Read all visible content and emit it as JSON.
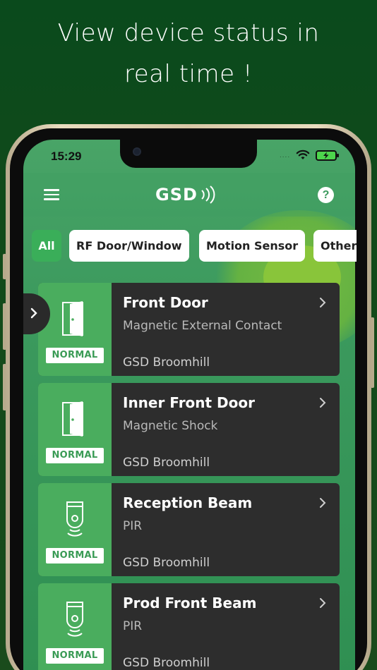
{
  "promo": {
    "line1": "View device status in",
    "line2": "real time !"
  },
  "status_bar": {
    "time": "15:29",
    "dots": "....",
    "wifi_icon": "wifi-icon",
    "battery_icon": "battery-charging-icon"
  },
  "header": {
    "menu_icon": "hamburger-icon",
    "logo": "GSD",
    "logo_icon": "signal-waves-icon",
    "help_label": "?"
  },
  "filters": [
    {
      "label": "All",
      "active": true
    },
    {
      "label": "RF Door/Window",
      "active": false
    },
    {
      "label": "Motion Sensor",
      "active": false
    },
    {
      "label": "Other",
      "active": false
    }
  ],
  "side_tab": {
    "icon": "chevron-right-icon"
  },
  "devices": [
    {
      "name": "Front Door",
      "type": "Magnetic External Contact",
      "location": "GSD Broomhill",
      "status": "NORMAL",
      "icon": "door-icon"
    },
    {
      "name": "Inner Front Door",
      "type": "Magnetic Shock",
      "location": "GSD Broomhill",
      "status": "NORMAL",
      "icon": "door-icon"
    },
    {
      "name": "Reception Beam",
      "type": "PIR",
      "location": "GSD Broomhill",
      "status": "NORMAL",
      "icon": "pir-sensor-icon"
    },
    {
      "name": "Prod Front Beam",
      "type": "PIR",
      "location": "GSD Broomhill",
      "status": "NORMAL",
      "icon": "pir-sensor-icon"
    }
  ],
  "colors": {
    "background": "#0a4a1c",
    "accent_green": "#4aad5e",
    "card_dark": "#2d2d2d",
    "screen_green": "#3c9a5e"
  }
}
